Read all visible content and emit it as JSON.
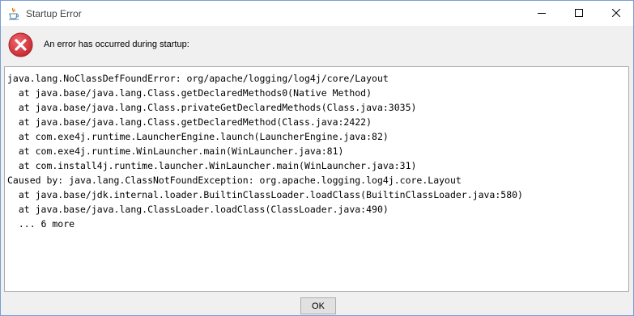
{
  "window": {
    "title": "Startup Error",
    "icons": {
      "app": "java-cup-icon",
      "minimize": "minimize-icon",
      "maximize": "maximize-icon",
      "close": "close-icon"
    }
  },
  "header": {
    "icon": "error-icon",
    "message": "An error has occurred during startup:"
  },
  "trace": {
    "lines": [
      "java.lang.NoClassDefFoundError: org/apache/logging/log4j/core/Layout",
      "  at java.base/java.lang.Class.getDeclaredMethods0(Native Method)",
      "  at java.base/java.lang.Class.privateGetDeclaredMethods(Class.java:3035)",
      "  at java.base/java.lang.Class.getDeclaredMethod(Class.java:2422)",
      "  at com.exe4j.runtime.LauncherEngine.launch(LauncherEngine.java:82)",
      "  at com.exe4j.runtime.WinLauncher.main(WinLauncher.java:81)",
      "  at com.install4j.runtime.launcher.WinLauncher.main(WinLauncher.java:31)",
      "Caused by: java.lang.ClassNotFoundException: org.apache.logging.log4j.core.Layout",
      "  at java.base/jdk.internal.loader.BuiltinClassLoader.loadClass(BuiltinClassLoader.java:580)",
      "  at java.base/java.lang.ClassLoader.loadClass(ClassLoader.java:490)",
      "  ... 6 more"
    ]
  },
  "footer": {
    "ok_label": "OK"
  },
  "colors": {
    "error_red": "#d9363e",
    "border_blue": "#7a9cd3"
  }
}
